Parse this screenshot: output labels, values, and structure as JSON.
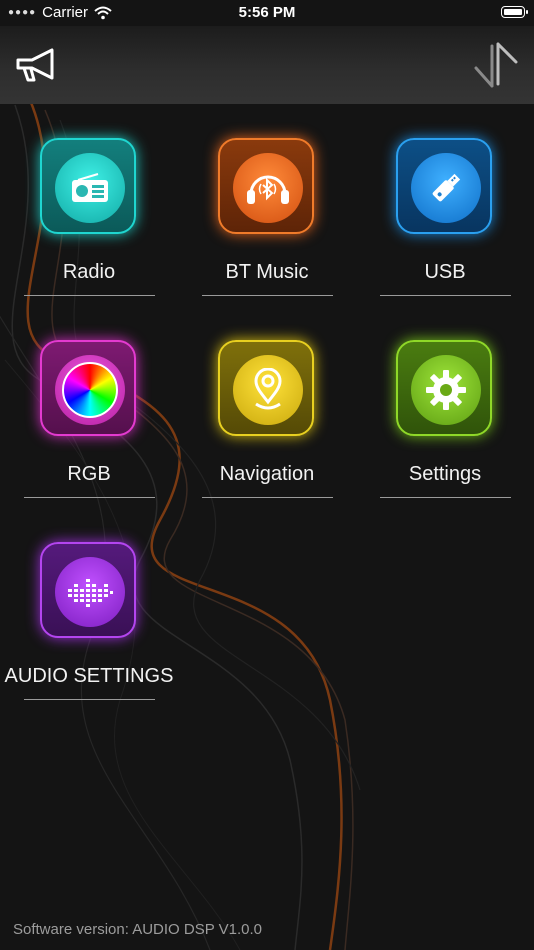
{
  "status_bar": {
    "carrier": "Carrier",
    "time": "5:56 PM"
  },
  "top_bar": {
    "left_icon": "megaphone-icon",
    "right_icon": "switch-arrows-icon"
  },
  "tiles": [
    {
      "label": "Radio",
      "icon": "radio-icon",
      "color": "#18c7c0"
    },
    {
      "label": "BT Music",
      "icon": "bluetooth-headphones-icon",
      "color": "#e5621c"
    },
    {
      "label": "USB",
      "icon": "usb-icon",
      "color": "#1a8ee0"
    },
    {
      "label": "RGB",
      "icon": "color-wheel-icon",
      "color": "#d62fc2"
    },
    {
      "label": "Navigation",
      "icon": "map-pin-icon",
      "color": "#d9c10f"
    },
    {
      "label": "Settings",
      "icon": "gear-icon",
      "color": "#79c41a"
    },
    {
      "label": "AUDIO SETTINGS",
      "icon": "equalizer-icon",
      "color": "#9b2fd8"
    }
  ],
  "footer": {
    "version": "Software version: AUDIO DSP V1.0.0"
  }
}
